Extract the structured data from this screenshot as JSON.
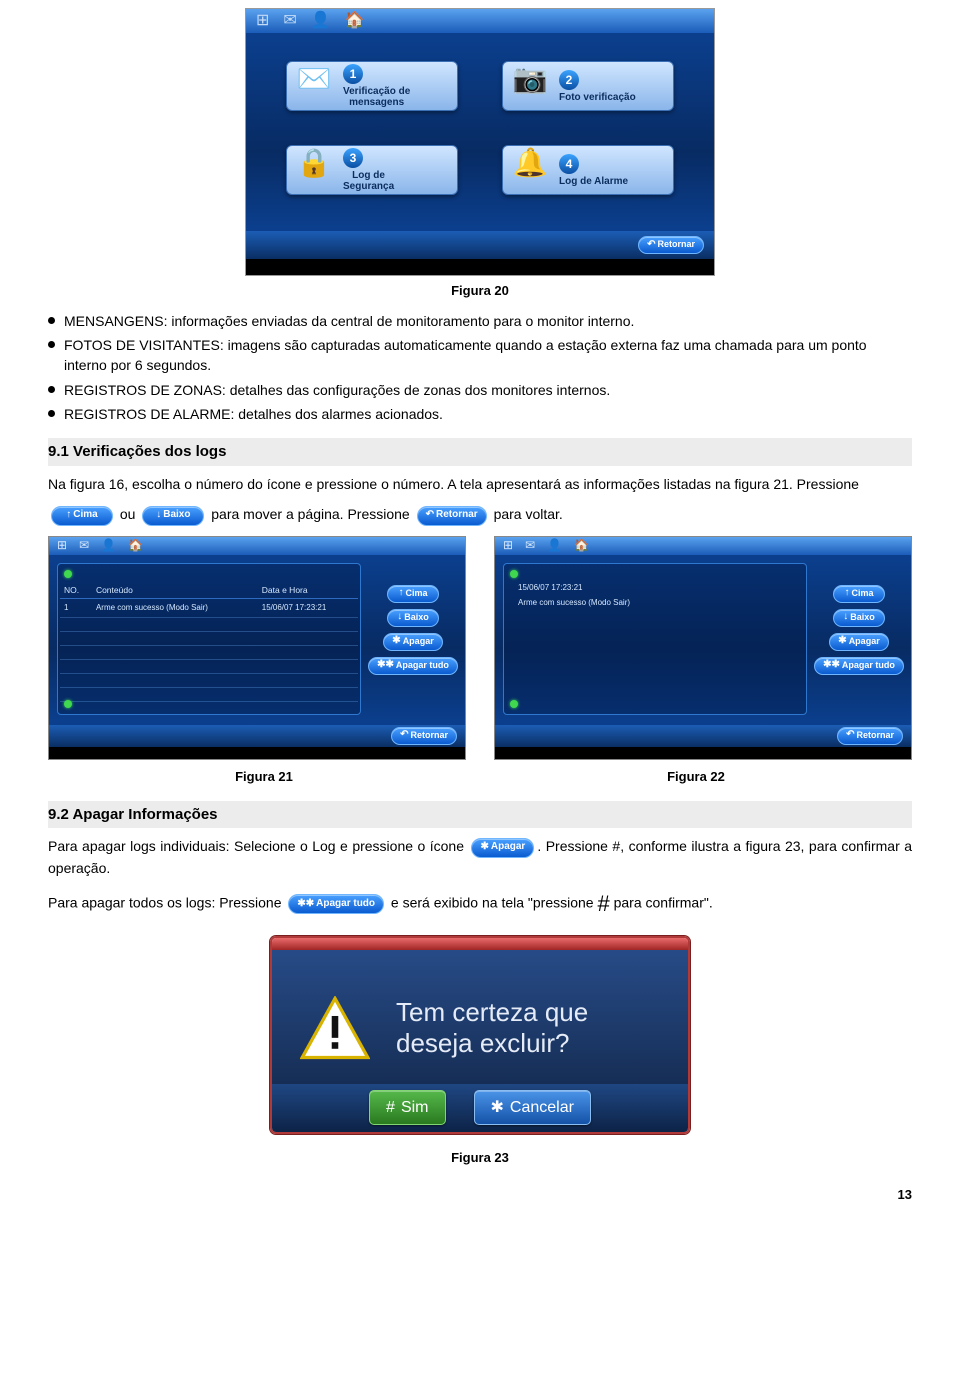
{
  "fig20": {
    "caption": "Figura 20",
    "tiles": [
      {
        "num": "1",
        "label_l1": "Verificação de",
        "label_l2": "mensagens"
      },
      {
        "num": "2",
        "label_l1": "Foto verificação",
        "label_l2": ""
      },
      {
        "num": "3",
        "label_l1": "Log de",
        "label_l2": "Segurança"
      },
      {
        "num": "4",
        "label_l1": "Log de Alarme",
        "label_l2": ""
      }
    ],
    "retornar": "Retornar"
  },
  "bullets": [
    "MENSANGENS: informações enviadas da central de monitoramento para o monitor interno.",
    "FOTOS DE VISITANTES: imagens são capturadas automaticamente quando a estação externa faz uma chamada para um ponto interno por 6 segundos.",
    "REGISTROS DE ZONAS: detalhes das configurações de zonas dos monitores internos.",
    "REGISTROS DE ALARME: detalhes dos alarmes acionados."
  ],
  "sec91": {
    "title": "9.1 Verificações dos logs",
    "text_before": "Na figura 16, escolha o número do ícone e pressione o número. A tela apresentará as informações listadas na figura 21. Pressione",
    "btn_cima": "Cima",
    "btn_baixo": "Baixo",
    "ou": "ou",
    "text_mid": "para mover a página. Pressione",
    "btn_retornar": "Retornar",
    "text_after": "para voltar."
  },
  "fig21": {
    "headers": {
      "no": "NO.",
      "conteudo": "Conteúdo",
      "datahora": "Data e Hora"
    },
    "row": {
      "no": "1",
      "conteudo": "Arme com sucesso (Modo Sair)",
      "dh": "15/06/07 17:23:21"
    },
    "btns": {
      "cima": "Cima",
      "baixo": "Baixo",
      "apagar": "Apagar",
      "apagartudo": "Apagar tudo",
      "retornar": "Retornar"
    },
    "caption": "Figura 21"
  },
  "fig22": {
    "dh": "15/06/07 17:23:21",
    "line2": "Arme com sucesso (Modo Sair)",
    "btns": {
      "cima": "Cima",
      "baixo": "Baixo",
      "apagar": "Apagar",
      "apagartudo": "Apagar tudo",
      "retornar": "Retornar"
    },
    "caption": "Figura 22"
  },
  "sec92": {
    "title": "9.2    Apagar Informações",
    "p1_a": "Para apagar logs individuais: Selecione o Log e pressione o ícone",
    "btn_apagar": "Apagar",
    "p1_b": ". Pressione #, conforme ilustra a figura 23, para confirmar a operação.",
    "p2_a": "Para apagar todos os logs: Pressione",
    "btn_apagartudo": "Apagar tudo",
    "p2_b": "e será exibido na tela \"pressione",
    "hash": "#",
    "p2_c": "para confirmar\"."
  },
  "fig23": {
    "msg_l1": "Tem certeza que",
    "msg_l2": "deseja excluir?",
    "yes_sym": "#",
    "yes": "Sim",
    "no_sym": "✱",
    "no": "Cancelar",
    "caption": "Figura 23"
  },
  "page_number": "13"
}
